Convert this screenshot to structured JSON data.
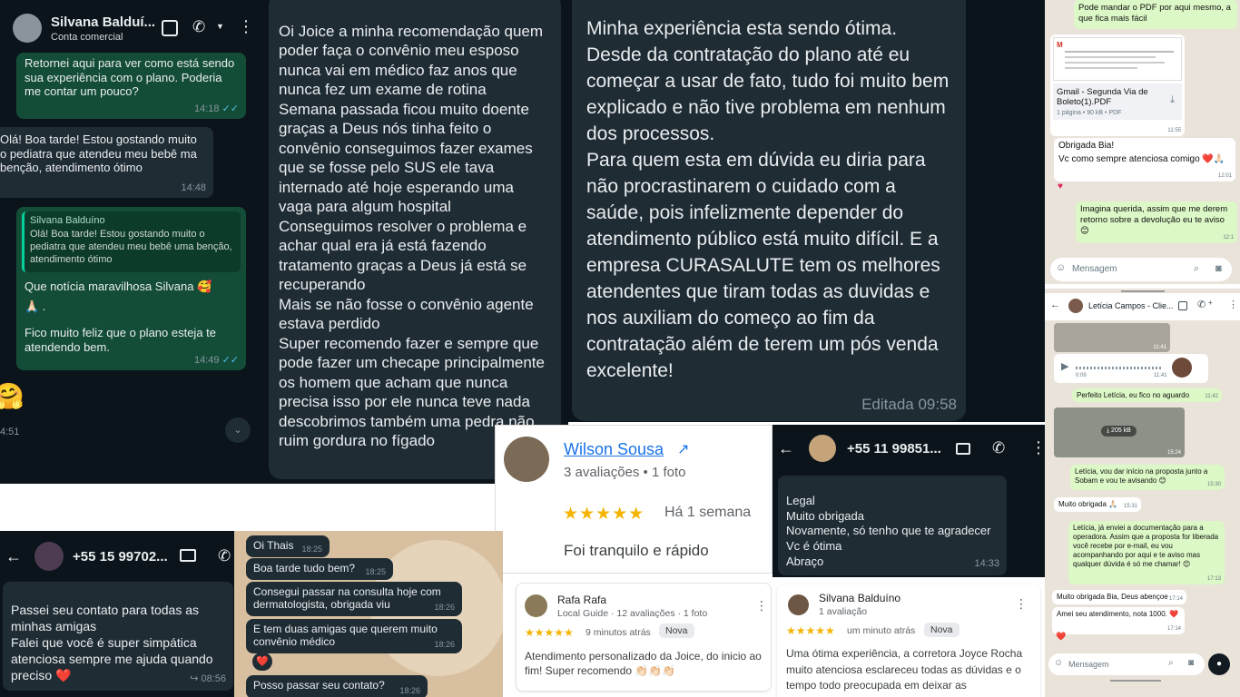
{
  "p1": {
    "contact": "Silvana Balduí...",
    "subtitle": "Conta comercial",
    "b1": "Retornei aqui para ver como está sendo sua experiência com o plano. Poderia me contar um pouco?",
    "b1t": "14:18",
    "b2": "Olá! Boa tarde! Estou gostando muito o pediatra que atendeu meu bebê ma benção, atendimento ótimo",
    "b2t": "14:48",
    "q_name": "Silvana Balduíno",
    "q_text": "Olá! Boa tarde! Estou gostando muito o pediatra que atendeu meu bebê uma benção, atendimento ótimo",
    "b3a": "Que notícia maravilhosa Silvana 🥰",
    "b3b": "🙏🏻 .",
    "b3c": "Fico muito feliz que o plano esteja te atendendo bem.",
    "b3t": "14:49",
    "edge_time": "4:51"
  },
  "p2": {
    "text": "Oi Joice a minha recomendação quem poder faça o convênio meu esposo nunca vai em médico faz anos que nunca fez um exame de rotina\nSemana passada ficou muito doente graças a Deus nós tinha feito o convênio conseguimos fazer exames que se fosse pelo SUS ele tava internado até hoje esperando uma vaga para algum hospital\nConseguimos resolver o problema e achar qual era já está fazendo tratamento graças a Deus já está se recuperando\nMais se não fosse o convênio agente estava perdido\nSuper recomendo fazer e sempre que pode fazer um checape principalmente os homem que acham que nunca precisa isso por ele nunca teve nada descobrimos também uma pedra não ruim gordura no fígado"
  },
  "p3": {
    "text": "Minha experiência esta sendo ótima. Desde da contratação do plano até eu começar a usar de fato, tudo foi muito bem explicado e não tive problema em nenhum dos processos.\nPara quem esta em dúvida eu diria para não procrastinarem o cuidado com a saúde, pois infelizmente depender do atendimento público está muito difícil. E a empresa CURASALUTE tem os melhores atendentes que tiram todas as duvidas e nos auxiliam do começo ao fim da contratação além de terem um pós venda excelente!",
    "edited": "Editada 09:58"
  },
  "p4": {
    "b1": "Pode mandar o PDF por aqui mesmo, a que fica mais fácil",
    "pdf_name": "Gmail - Segunda Via de Boleto(1).PDF",
    "pdf_meta": "1 página • 90 kB • PDF",
    "pdf_time": "11:55",
    "b2a": "Obrigada Bia!",
    "b2b": "Vc como sempre atenciosa comigo ❤️🙏🏻",
    "b2t": "12:01",
    "b3": "Imagina querida, assim que me derem retorno sobre a devolução eu te aviso 😊",
    "b3t": "12:1",
    "input": "Mensagem"
  },
  "p5": {
    "name": "Wilson Sousa",
    "meta": "3 avaliações • 1 foto",
    "stars": "★★★★★",
    "when": "Há 1 semana",
    "review": "Foi tranquilo e rápido"
  },
  "p6": {
    "contact": "+55 15 99702...",
    "text": "Passei seu contato para todas as minhas amigas\nFalei que você é super simpática atenciosa sempre me ajuda quando preciso ❤️",
    "time": "08:56"
  },
  "p7": {
    "m1": "Oi Thais",
    "t1": "18:25",
    "m2": "Boa tarde tudo bem?",
    "t2": "18:25",
    "m3": "Consegui passar na consulta hoje com dermatologista, obrigada viu",
    "t3": "18:26",
    "m4": "E tem duas amigas que querem muito convênio médico",
    "t4": "18:26",
    "react": "❤️",
    "m5": "Posso passar seu contato?",
    "t5": "18:26"
  },
  "p8": {
    "name": "Rafa Rafa",
    "meta": "Local Guide · 12 avaliações · 1 foto",
    "stars": "★★★★★",
    "when": "9 minutos atrás",
    "badge": "Nova",
    "review": "Atendimento personalizado da Joice, do inicio ao fim! Super recomendo 👏🏻👏🏻👏🏻"
  },
  "p9": {
    "contact": "+55 11 99851...",
    "text": "Legal\nMuito obrigada\nNovamente, só tenho que te agradecer\nVc é ótima\nAbraço",
    "time": "14:33"
  },
  "p10": {
    "name": "Silvana Balduíno",
    "meta": "1 avaliação",
    "stars": "★★★★★",
    "when": "um minuto atrás",
    "badge": "Nova",
    "review": "Uma ótima experiência, a corretora Joyce Rocha muito atenciosa esclareceu todas as dúvidas e o tempo todo preocupada em deixar as"
  },
  "p11": {
    "contact": "Letícia Campos - Clie...",
    "t_img1": "11:41",
    "audio_len": "0:09",
    "audio_time": "11:41",
    "m1": "Perfeito Letícia, eu fico no aguardo",
    "m1t": "11:42",
    "video_size": "205 kB",
    "video_time": "15:24",
    "m2": "Letícia, vou dar início na proposta junto a Sobam e vou te avisando 😊",
    "m2t": "15:30",
    "m3": "Muito obrigada 🙏🏻",
    "m3t": "15:31",
    "m4": "Letícia, já enviei a documentação para a operadora. Assim que a proposta for liberada você recebe por e-mail, eu vou acompanhando por aqui e te aviso mas qualquer dúvida é só me chamar! 😊",
    "m4t": "17:13",
    "m5": "Muito obrigada Bia, Deus abençoe",
    "m5t": "17:14",
    "m6": "Amei seu atendimento, nota 1000. ❤️",
    "m6t": "17:14",
    "react": "❤️",
    "input": "Mensagem"
  }
}
